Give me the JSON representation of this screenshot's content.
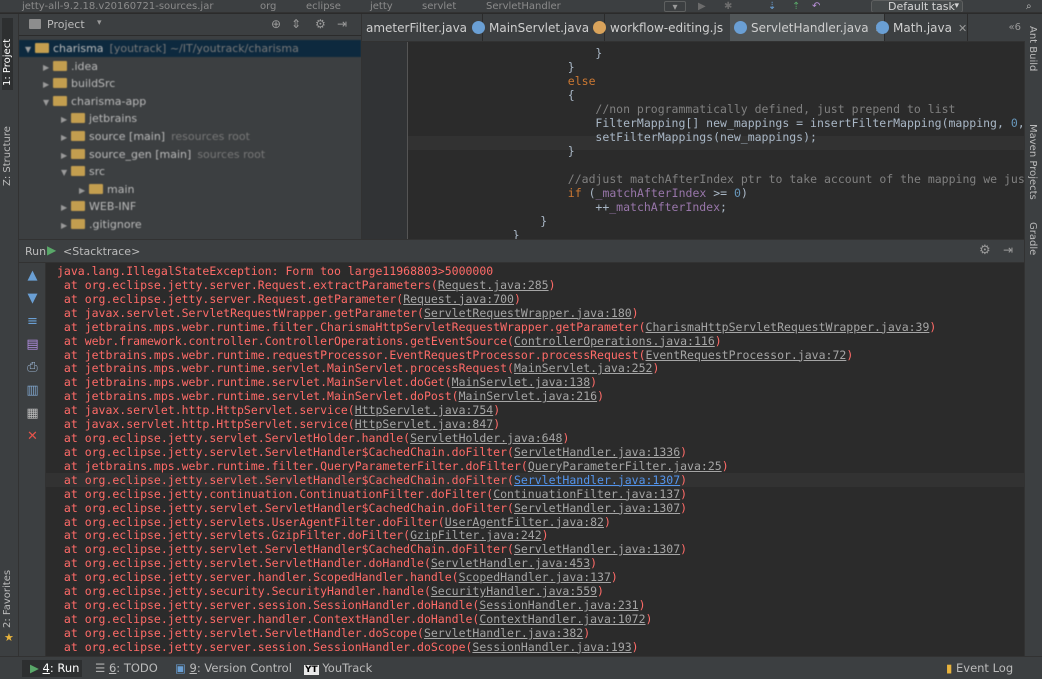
{
  "topbar": {
    "crumbs": [
      "jetty-all-9.2.18.v20160721-sources.jar",
      "org",
      "eclipse",
      "jetty",
      "servlet",
      "ServletHandler"
    ],
    "run_config": "Default task"
  },
  "left_strip": {
    "project": "1: Project",
    "structure": "Z: Structure",
    "favorites": "2: Favorites"
  },
  "right_strip": {
    "ant": "Ant Build",
    "maven": "Maven Projects",
    "gradle": "Gradle"
  },
  "project_pane": {
    "title": "Project",
    "tree": [
      {
        "label": "charisma",
        "dim": "[youtrack] ~/IT/youtrack/charisma",
        "depth": 0,
        "open": true,
        "selected": true
      },
      {
        "label": ".idea",
        "dim": "",
        "depth": 1,
        "open": false
      },
      {
        "label": "buildSrc",
        "dim": "",
        "depth": 1,
        "open": false
      },
      {
        "label": "charisma-app",
        "dim": "",
        "depth": 1,
        "open": true
      },
      {
        "label": "jetbrains",
        "dim": "",
        "depth": 2,
        "open": false
      },
      {
        "label": "source [main]",
        "dim": "resources root",
        "depth": 2,
        "open": false
      },
      {
        "label": "source_gen [main]",
        "dim": "sources root",
        "depth": 2,
        "open": false
      },
      {
        "label": "src",
        "dim": "",
        "depth": 2,
        "open": true
      },
      {
        "label": "main",
        "dim": "",
        "depth": 3,
        "open": false
      },
      {
        "label": "WEB-INF",
        "dim": "",
        "depth": 2,
        "open": false
      },
      {
        "label": ".gitignore",
        "dim": "",
        "depth": 2,
        "open": false
      }
    ]
  },
  "editor": {
    "tabs": [
      {
        "label": "ameterFilter.java",
        "icon_color": "#c9a45c",
        "active": false
      },
      {
        "label": "MainServlet.java",
        "icon_color": "#6a9fd4",
        "active": false
      },
      {
        "label": "workflow-editing.js",
        "icon_color": "#d9a35b",
        "active": false
      },
      {
        "label": "ServletHandler.java",
        "icon_color": "#6a9fd4",
        "active": true
      },
      {
        "label": "Math.java",
        "icon_color": "#6a9fd4",
        "active": false
      }
    ],
    "tabs_overflow": "6",
    "code": [
      {
        "indent": 26,
        "parts": [
          [
            "plain",
            "}"
          ]
        ]
      },
      {
        "indent": 22,
        "parts": [
          [
            "plain",
            "}"
          ]
        ]
      },
      {
        "indent": 22,
        "parts": [
          [
            "kw",
            "else"
          ]
        ]
      },
      {
        "indent": 22,
        "parts": [
          [
            "plain",
            "{"
          ]
        ]
      },
      {
        "indent": 26,
        "parts": [
          [
            "cm",
            "//non programmatically defined, just prepend to list"
          ]
        ]
      },
      {
        "indent": 26,
        "parts": [
          [
            "plain",
            "FilterMapping[] new_mappings = insertFilterMapping(mapping, "
          ],
          [
            "num",
            "0"
          ],
          [
            "plain",
            ", "
          ],
          [
            "kw",
            "true"
          ],
          [
            "plain",
            ");"
          ]
        ]
      },
      {
        "indent": 26,
        "parts": [
          [
            "plain",
            "setFilterMappings(new_mappings);"
          ]
        ]
      },
      {
        "indent": 22,
        "parts": [
          [
            "plain",
            "}"
          ]
        ]
      },
      {
        "indent": 0,
        "parts": [
          [
            "plain",
            ""
          ]
        ]
      },
      {
        "indent": 22,
        "parts": [
          [
            "cm",
            "//adjust matchAfterIndex ptr to take account of the mapping we just prepended"
          ]
        ]
      },
      {
        "indent": 22,
        "parts": [
          [
            "kw",
            "if"
          ],
          [
            "plain",
            " ("
          ],
          [
            "fld",
            "_matchAfterIndex"
          ],
          [
            "plain",
            " >= "
          ],
          [
            "num",
            "0"
          ],
          [
            "plain",
            ")"
          ]
        ]
      },
      {
        "indent": 26,
        "parts": [
          [
            "plain",
            "++"
          ],
          [
            "fld",
            "_matchAfterIndex"
          ],
          [
            "plain",
            ";"
          ]
        ]
      },
      {
        "indent": 18,
        "parts": [
          [
            "plain",
            "}"
          ]
        ]
      },
      {
        "indent": 14,
        "parts": [
          [
            "plain",
            "}"
          ]
        ]
      }
    ]
  },
  "run": {
    "label": "Run",
    "tab": "<Stacktrace>"
  },
  "console": [
    {
      "pre": "java.lang.IllegalStateException: Form too large11968803>5000000",
      "link": "",
      "post": ""
    },
    {
      "pre": " at org.eclipse.jetty.server.Request.extractParameters(",
      "link": "Request.java:285",
      "post": ")"
    },
    {
      "pre": " at org.eclipse.jetty.server.Request.getParameter(",
      "link": "Request.java:700",
      "post": ")"
    },
    {
      "pre": " at javax.servlet.ServletRequestWrapper.getParameter(",
      "link": "ServletRequestWrapper.java:180",
      "post": ")"
    },
    {
      "pre": " at jetbrains.mps.webr.runtime.filter.CharismaHttpServletRequestWrapper.getParameter(",
      "link": "CharismaHttpServletRequestWrapper.java:39",
      "post": ")"
    },
    {
      "pre": " at webr.framework.controller.ControllerOperations.getEventSource(",
      "link": "ControllerOperations.java:116",
      "post": ")"
    },
    {
      "pre": " at jetbrains.mps.webr.runtime.requestProcessor.EventRequestProcessor.processRequest(",
      "link": "EventRequestProcessor.java:72",
      "post": ")"
    },
    {
      "pre": " at jetbrains.mps.webr.runtime.servlet.MainServlet.processRequest(",
      "link": "MainServlet.java:252",
      "post": ")"
    },
    {
      "pre": " at jetbrains.mps.webr.runtime.servlet.MainServlet.doGet(",
      "link": "MainServlet.java:138",
      "post": ")"
    },
    {
      "pre": " at jetbrains.mps.webr.runtime.servlet.MainServlet.doPost(",
      "link": "MainServlet.java:216",
      "post": ")"
    },
    {
      "pre": " at javax.servlet.http.HttpServlet.service(",
      "link": "HttpServlet.java:754",
      "post": ")"
    },
    {
      "pre": " at javax.servlet.http.HttpServlet.service(",
      "link": "HttpServlet.java:847",
      "post": ")"
    },
    {
      "pre": " at org.eclipse.jetty.servlet.ServletHolder.handle(",
      "link": "ServletHolder.java:648",
      "post": ")"
    },
    {
      "pre": " at org.eclipse.jetty.servlet.ServletHandler$CachedChain.doFilter(",
      "link": "ServletHandler.java:1336",
      "post": ")"
    },
    {
      "pre": " at jetbrains.mps.webr.runtime.filter.QueryParameterFilter.doFilter(",
      "link": "QueryParameterFilter.java:25",
      "post": ")"
    },
    {
      "pre": " at org.eclipse.jetty.servlet.ServletHandler$CachedChain.doFilter(",
      "link": "ServletHandler.java:1307",
      "post": ")",
      "highlight": true
    },
    {
      "pre": " at org.eclipse.jetty.continuation.ContinuationFilter.doFilter(",
      "link": "ContinuationFilter.java:137",
      "post": ")"
    },
    {
      "pre": " at org.eclipse.jetty.servlet.ServletHandler$CachedChain.doFilter(",
      "link": "ServletHandler.java:1307",
      "post": ")"
    },
    {
      "pre": " at org.eclipse.jetty.servlets.UserAgentFilter.doFilter(",
      "link": "UserAgentFilter.java:82",
      "post": ")"
    },
    {
      "pre": " at org.eclipse.jetty.servlets.GzipFilter.doFilter(",
      "link": "GzipFilter.java:242",
      "post": ")"
    },
    {
      "pre": " at org.eclipse.jetty.servlet.ServletHandler$CachedChain.doFilter(",
      "link": "ServletHandler.java:1307",
      "post": ")"
    },
    {
      "pre": " at org.eclipse.jetty.servlet.ServletHandler.doHandle(",
      "link": "ServletHandler.java:453",
      "post": ")"
    },
    {
      "pre": " at org.eclipse.jetty.server.handler.ScopedHandler.handle(",
      "link": "ScopedHandler.java:137",
      "post": ")"
    },
    {
      "pre": " at org.eclipse.jetty.security.SecurityHandler.handle(",
      "link": "SecurityHandler.java:559",
      "post": ")"
    },
    {
      "pre": " at org.eclipse.jetty.server.session.SessionHandler.doHandle(",
      "link": "SessionHandler.java:231",
      "post": ")"
    },
    {
      "pre": " at org.eclipse.jetty.server.handler.ContextHandler.doHandle(",
      "link": "ContextHandler.java:1072",
      "post": ")"
    },
    {
      "pre": " at org.eclipse.jetty.servlet.ServletHandler.doScope(",
      "link": "ServletHandler.java:382",
      "post": ")"
    },
    {
      "pre": " at org.eclipse.jetty.server.session.SessionHandler.doScope(",
      "link": "SessionHandler.java:193",
      "post": ")"
    }
  ],
  "bottom": {
    "run_num": "4",
    "run": ": Run",
    "todo_num": "6",
    "todo": ": TODO",
    "vcs_num": "9",
    "vcs": ": Version Control",
    "youtrack": "YouTrack",
    "event_log": "Event Log"
  },
  "colors": {
    "error_text": "#ff6b68",
    "link_highlight": "#5394ec",
    "run_green": "#59a869"
  }
}
